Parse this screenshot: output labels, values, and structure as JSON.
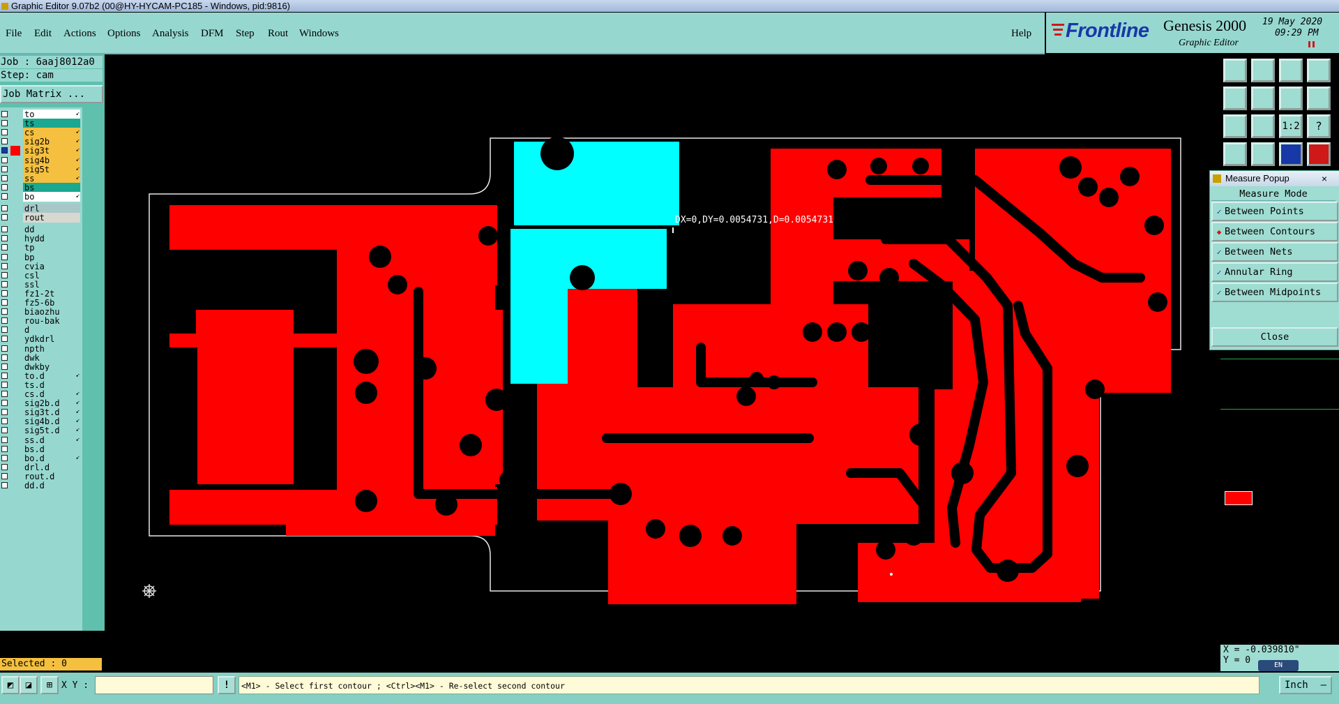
{
  "window": {
    "title": "Graphic Editor 9.07b2 (00@HY-HYCAM-PC185 - Windows, pid:9816)"
  },
  "menu": {
    "items": [
      "File",
      "Edit",
      "Actions",
      "Options",
      "Analysis",
      "DFM",
      "Step",
      "Rout",
      "Windows"
    ],
    "help": "Help"
  },
  "brand": {
    "logo": "Frontline",
    "product": "Genesis 2000",
    "subtitle": "Graphic Editor",
    "date": "19 May 2020",
    "time": "09:29 PM"
  },
  "job": {
    "job": "Job : 6aaj8012a0",
    "step": "Step: cam",
    "matrix_button": "Job Matrix ..."
  },
  "layers": [
    {
      "name": "to",
      "color": "#ffffff",
      "arrow": true,
      "sw": ""
    },
    {
      "name": "ts",
      "color": "#1aa890",
      "arrow": false,
      "sw": ""
    },
    {
      "name": "cs",
      "color": "#f5c040",
      "arrow": true,
      "sw": ""
    },
    {
      "name": "sig2b",
      "color": "#f5c040",
      "arrow": true,
      "sw": ""
    },
    {
      "name": "sig3t",
      "color": "#f5c040",
      "arrow": true,
      "sw": "#ff0000",
      "active": true
    },
    {
      "name": "sig4b",
      "color": "#f5c040",
      "arrow": true,
      "sw": ""
    },
    {
      "name": "sig5t",
      "color": "#f5c040",
      "arrow": true,
      "sw": ""
    },
    {
      "name": "ss",
      "color": "#f5c040",
      "arrow": true,
      "sw": ""
    },
    {
      "name": "bs",
      "color": "#1aa890",
      "arrow": false,
      "sw": ""
    },
    {
      "name": "bo",
      "color": "#ffffff",
      "arrow": true,
      "sw": ""
    },
    {
      "name": "drl",
      "color": "#a8c8c8",
      "arrow": false,
      "sw": "",
      "gap": true
    },
    {
      "name": "rout",
      "color": "#d8d8d0",
      "arrow": false,
      "sw": ""
    },
    {
      "name": "dd",
      "color": "#96d8d0",
      "arrow": false,
      "sw": "",
      "gap": true
    },
    {
      "name": "hydd",
      "color": "#96d8d0",
      "arrow": false,
      "sw": ""
    },
    {
      "name": "tp",
      "color": "#96d8d0",
      "arrow": false,
      "sw": ""
    },
    {
      "name": "bp",
      "color": "#96d8d0",
      "arrow": false,
      "sw": ""
    },
    {
      "name": "cvia",
      "color": "#96d8d0",
      "arrow": false,
      "sw": ""
    },
    {
      "name": "csl",
      "color": "#96d8d0",
      "arrow": false,
      "sw": ""
    },
    {
      "name": "ssl",
      "color": "#96d8d0",
      "arrow": false,
      "sw": ""
    },
    {
      "name": "fz1-2t",
      "color": "#96d8d0",
      "arrow": false,
      "sw": ""
    },
    {
      "name": "fz5-6b",
      "color": "#96d8d0",
      "arrow": false,
      "sw": ""
    },
    {
      "name": "biaozhu",
      "color": "#96d8d0",
      "arrow": false,
      "sw": ""
    },
    {
      "name": "rou-bak",
      "color": "#96d8d0",
      "arrow": false,
      "sw": ""
    },
    {
      "name": "d",
      "color": "#96d8d0",
      "arrow": false,
      "sw": ""
    },
    {
      "name": "ydkdrl",
      "color": "#96d8d0",
      "arrow": false,
      "sw": ""
    },
    {
      "name": "npth",
      "color": "#96d8d0",
      "arrow": false,
      "sw": ""
    },
    {
      "name": "dwk",
      "color": "#96d8d0",
      "arrow": false,
      "sw": ""
    },
    {
      "name": "dwkby",
      "color": "#96d8d0",
      "arrow": false,
      "sw": ""
    },
    {
      "name": "to.d",
      "color": "#96d8d0",
      "arrow": true,
      "sw": ""
    },
    {
      "name": "ts.d",
      "color": "#96d8d0",
      "arrow": false,
      "sw": ""
    },
    {
      "name": "cs.d",
      "color": "#96d8d0",
      "arrow": true,
      "sw": ""
    },
    {
      "name": "sig2b.d",
      "color": "#96d8d0",
      "arrow": true,
      "sw": ""
    },
    {
      "name": "sig3t.d",
      "color": "#96d8d0",
      "arrow": true,
      "sw": ""
    },
    {
      "name": "sig4b.d",
      "color": "#96d8d0",
      "arrow": true,
      "sw": ""
    },
    {
      "name": "sig5t.d",
      "color": "#96d8d0",
      "arrow": true,
      "sw": ""
    },
    {
      "name": "ss.d",
      "color": "#96d8d0",
      "arrow": true,
      "sw": ""
    },
    {
      "name": "bs.d",
      "color": "#96d8d0",
      "arrow": false,
      "sw": ""
    },
    {
      "name": "bo.d",
      "color": "#96d8d0",
      "arrow": true,
      "sw": ""
    },
    {
      "name": "drl.d",
      "color": "#96d8d0",
      "arrow": false,
      "sw": ""
    },
    {
      "name": "rout.d",
      "color": "#96d8d0",
      "arrow": false,
      "sw": ""
    },
    {
      "name": "dd.d",
      "color": "#96d8d0",
      "arrow": false,
      "sw": ""
    }
  ],
  "selected": "Selected : 0",
  "canvas": {
    "measure_readout": "DX=0,DY=0.0054731,D=0.0054731",
    "copper_color": "#ff0000",
    "highlight_color": "#00ffff"
  },
  "measure_popup": {
    "title": "Measure Popup",
    "header": "Measure Mode",
    "options": [
      {
        "label": "Between Points",
        "selected": false
      },
      {
        "label": "Between Contours",
        "selected": true
      },
      {
        "label": "Between Nets",
        "selected": false
      },
      {
        "label": "Annular Ring",
        "selected": false
      },
      {
        "label": "Between Midpoints",
        "selected": false
      }
    ],
    "close": "Close"
  },
  "toolbar": {
    "ratio_label": "1:2",
    "help_label": "?"
  },
  "coords": {
    "x": "X = -0.039810\"",
    "y": "Y = 0"
  },
  "ime": "EN",
  "status": {
    "xy_label": "X Y :",
    "prompt": "<M1> - Select first contour ; <Ctrl><M1> - Re-select second contour",
    "unit": "Inch"
  }
}
